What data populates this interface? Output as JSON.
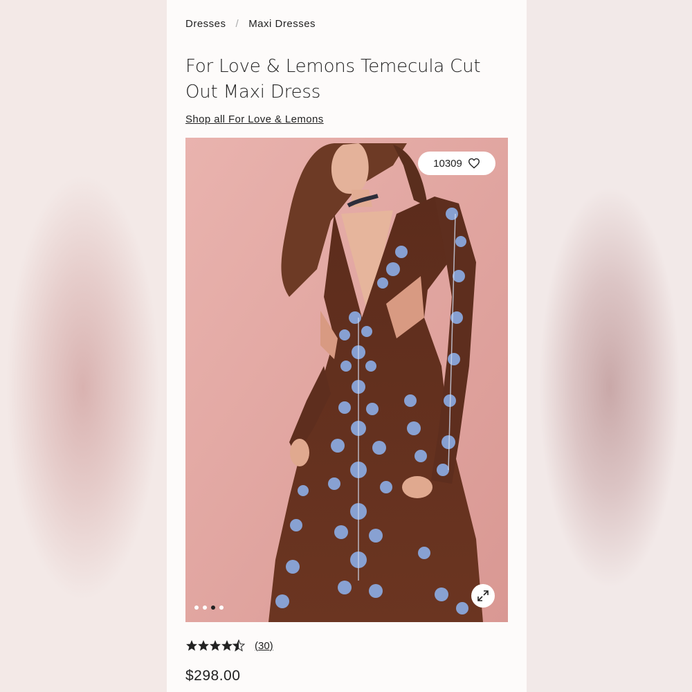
{
  "breadcrumb": {
    "items": [
      "Dresses",
      "Maxi Dresses"
    ],
    "separator": "/"
  },
  "product": {
    "title": "For Love & Lemons Temecula Cut Out Maxi Dress",
    "shop_link": "Shop all For Love & Lemons",
    "likes": "10309",
    "rating": 4.5,
    "review_count": "(30)",
    "price": "$298.00"
  },
  "gallery": {
    "image_count": 4,
    "active_index": 2
  },
  "icons": {
    "heart": "heart-icon",
    "expand": "expand-icon",
    "star": "star-icon"
  },
  "colors": {
    "text": "#222222",
    "panel": "#fdfbfa",
    "image_bg": "#e3aaa6",
    "dress": "#5a2d1f",
    "embroidery": "#7f9fd6"
  }
}
